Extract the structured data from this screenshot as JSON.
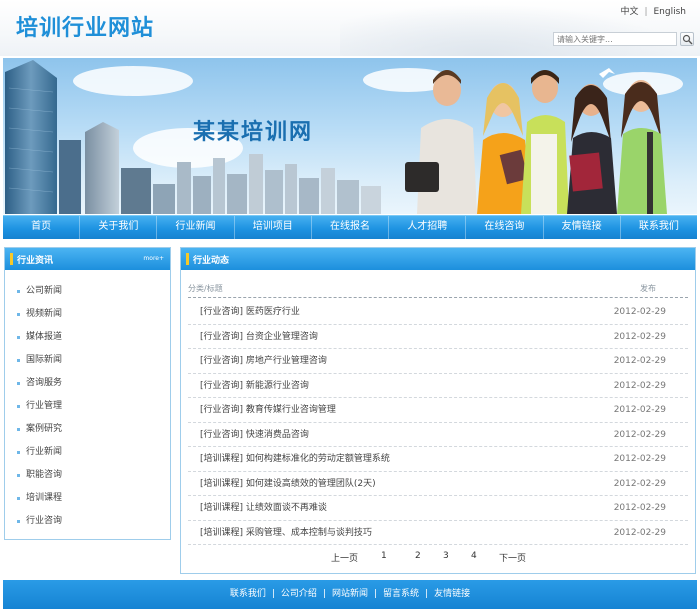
{
  "header": {
    "site_title": "培训行业网站",
    "lang_cn": "中文",
    "lang_sep": "|",
    "lang_en": "English",
    "search_placeholder": "请输入关键字..."
  },
  "banner": {
    "title": "某某培训网"
  },
  "nav": {
    "items": [
      "首页",
      "关于我们",
      "行业新闻",
      "培训项目",
      "在线报名",
      "人才招聘",
      "在线咨询",
      "友情链接",
      "联系我们"
    ]
  },
  "sidebar": {
    "title": "行业资讯",
    "more": "more+",
    "items": [
      "公司新闻",
      "视频新闻",
      "媒体报道",
      "国际新闻",
      "咨询服务",
      "行业管理",
      "案例研究",
      "行业新闻",
      "职能咨询",
      "培训课程",
      "行业咨询"
    ]
  },
  "main": {
    "title": "行业动态",
    "col_category": "分类/标题",
    "col_date": "发布",
    "news": [
      {
        "title": "[行业咨询] 医药医疗行业",
        "date": "2012-02-29"
      },
      {
        "title": "[行业咨询] 台资企业管理咨询",
        "date": "2012-02-29"
      },
      {
        "title": "[行业咨询] 房地产行业管理咨询",
        "date": "2012-02-29"
      },
      {
        "title": "[行业咨询] 新能源行业咨询",
        "date": "2012-02-29"
      },
      {
        "title": "[行业咨询] 教育传媒行业咨询管理",
        "date": "2012-02-29"
      },
      {
        "title": "[行业咨询] 快速消费品咨询",
        "date": "2012-02-29"
      },
      {
        "title": "[培训课程] 如何构建标准化的劳动定额管理系统",
        "date": "2012-02-29"
      },
      {
        "title": "[培训课程] 如何建设高绩效的管理团队(2天)",
        "date": "2012-02-29"
      },
      {
        "title": "[培训课程] 让绩效面谈不再难谈",
        "date": "2012-02-29"
      },
      {
        "title": "[培训课程] 采购管理、成本控制与谈判技巧",
        "date": "2012-02-29"
      }
    ],
    "pager": {
      "prev": "上一页",
      "pages": [
        "1",
        "2",
        "3",
        "4"
      ],
      "next": "下一页"
    }
  },
  "footer": {
    "links": [
      "联系我们",
      "公司介绍",
      "网站新闻",
      "留言系统",
      "友情链接"
    ],
    "sep": "|"
  },
  "colors": {
    "brand_blue": "#1f8fd8",
    "nav_blue": "#1e93e2",
    "accent_yellow": "#f7c928"
  }
}
